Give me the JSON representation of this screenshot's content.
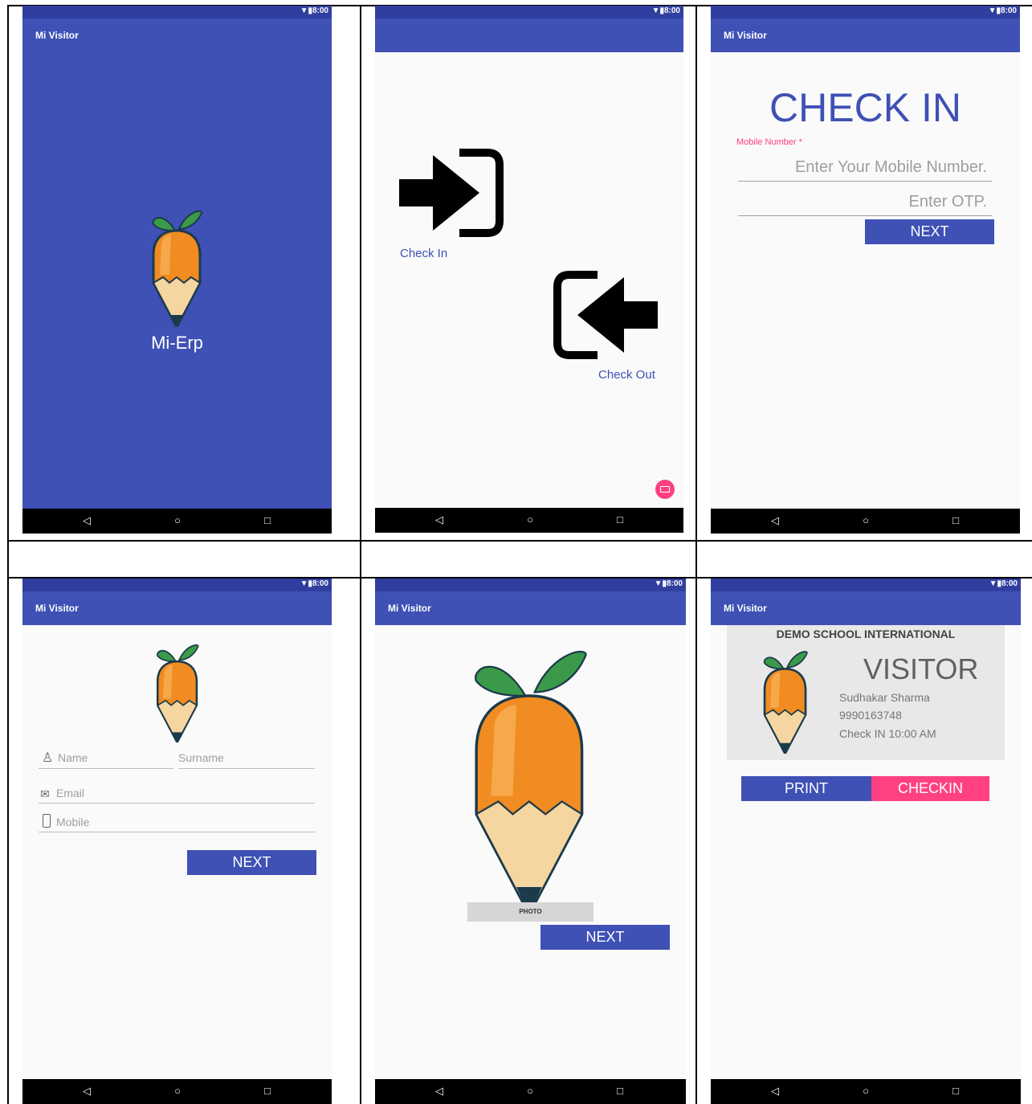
{
  "status_icons": "▼▮8:00",
  "app_title": "Mi Visitor",
  "nav": {
    "back": "◁",
    "home": "○",
    "recent": "□"
  },
  "splash": {
    "app_name": "Mi-Erp"
  },
  "home": {
    "check_in": "Check In",
    "check_out": "Check Out"
  },
  "check_in_screen": {
    "title": "CHECK IN",
    "mobile_label": "Mobile Number *",
    "mobile_placeholder": "Enter Your Mobile Number.",
    "otp_placeholder": "Enter OTP.",
    "next": "NEXT"
  },
  "register": {
    "name_placeholder": "Name",
    "surname_placeholder": "Surname",
    "email_placeholder": "Email",
    "mobile_placeholder": "Mobile",
    "next": "NEXT"
  },
  "photo": {
    "photo_label": "PHOTO",
    "next": "NEXT"
  },
  "pass": {
    "school": "DEMO SCHOOL INTERNATIONAL",
    "visitor_label": "VISITOR",
    "name": "Sudhakar Sharma",
    "mobile": "9990163748",
    "checkin_time": "Check IN 10:00 AM",
    "print": "PRINT",
    "checkin": "CHECKIN"
  },
  "colors": {
    "primary": "#3f51b5",
    "primary_dark": "#303f9f",
    "accent": "#ff4081",
    "orange": "#f08c21",
    "leaf": "#3b9a4a"
  }
}
